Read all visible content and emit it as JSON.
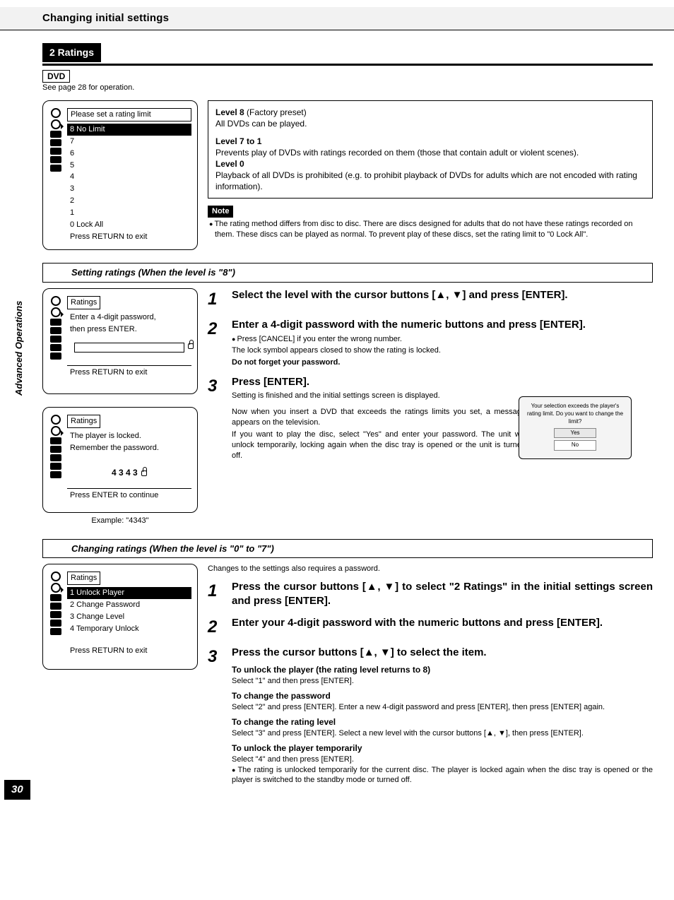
{
  "header": {
    "title": "Changing initial settings"
  },
  "sidebar": {
    "label": "Advanced Operations"
  },
  "page_number": "30",
  "ratings_tab": "2  Ratings",
  "dvd_badge": "DVD",
  "see_page": "See page 28 for operation.",
  "osd1": {
    "box_title": "Please set a rating limit",
    "sel": "8 No Limit",
    "lines": [
      "7",
      "6",
      "5",
      "4",
      "3",
      "2",
      "1",
      "0 Lock All",
      "Press RETURN to exit"
    ]
  },
  "levels_box": {
    "l8_title": "Level 8",
    "l8_paren": " (Factory preset)",
    "l8_desc": "All DVDs can be played.",
    "l71_title": "Level 7 to 1",
    "l71_desc": "Prevents play of DVDs with ratings recorded on them (those that contain adult or violent scenes).",
    "l0_title": "Level 0",
    "l0_desc": "Playback of all DVDs is prohibited (e.g. to prohibit playback of DVDs for adults which are not encoded with rating information)."
  },
  "note_label": "Note",
  "note_text": "The rating method differs from disc to disc. There are discs designed for adults that do not have these ratings recorded on them. These discs can be played as normal. To prevent play of these discs, set the rating limit to \"0 Lock All\".",
  "subhead1": "Setting ratings (When the level is \"8\")",
  "osd2": {
    "title": "Ratings",
    "l1": "Enter a 4-digit password,",
    "l2": "then press ENTER.",
    "footer": "Press RETURN to exit"
  },
  "osd3": {
    "title": "Ratings",
    "l1": "The player is locked.",
    "l2": "Remember the password.",
    "pw": "4 3 4 3",
    "footer": "Press ENTER to continue"
  },
  "example_caption": "Example:  \"4343\"",
  "steps1": {
    "s1": "Select the level with the cursor buttons [▲, ▼] and press [ENTER].",
    "s2": "Enter a 4-digit password with the numeric buttons and press [ENTER].",
    "s2n1": "Press [CANCEL] if you enter the wrong number.",
    "s2n2": "The lock symbol appears closed to show the rating is locked.",
    "s2n3": "Do not forget your password.",
    "s3": "Press [ENTER].",
    "s3n1": "Setting is finished and the initial settings screen is displayed.",
    "s3p1": "Now when you insert a DVD that exceeds the ratings limits you set, a message appears on the television.",
    "s3p2": "If you want to play the disc, select \"Yes\" and enter your password. The unit will unlock temporarily, locking again when the disc tray is opened or the unit is turned off."
  },
  "tv": {
    "msg": "Your selection exceeds the player's rating limit. Do you want to change the limit?",
    "yes": "Yes",
    "no": "No"
  },
  "subhead2": "Changing ratings (When the level is \"0\" to \"7\")",
  "changes_intro": "Changes to the settings also requires a password.",
  "osd4": {
    "title": "Ratings",
    "sel": "1 Unlock Player",
    "l2": "2 Change Password",
    "l3": "3 Change Level",
    "l4": "4 Temporary Unlock",
    "footer": "Press RETURN to exit"
  },
  "steps2": {
    "s1": "Press the cursor buttons [▲, ▼] to select \"2 Ratings\" in the initial settings screen and press [ENTER].",
    "s2": "Enter your 4-digit password with the numeric buttons and press [ENTER].",
    "s3": "Press the cursor buttons [▲, ▼] to select the item.",
    "i1t": "To unlock the player (the rating level returns to 8)",
    "i1d": "Select \"1\" and then press [ENTER].",
    "i2t": "To change the password",
    "i2d": "Select \"2\" and press [ENTER]. Enter a new 4-digit password and press [ENTER], then press [ENTER] again.",
    "i3t": "To change the rating level",
    "i3d": "Select \"3\" and press [ENTER]. Select a new level with the cursor buttons [▲, ▼], then press [ENTER].",
    "i4t": "To unlock the player temporarily",
    "i4d1": "Select \"4\" and then press [ENTER].",
    "i4d2": "The rating is unlocked temporarily for the current disc. The player is locked again when the disc tray is opened or the player is switched to the standby mode or turned off."
  }
}
